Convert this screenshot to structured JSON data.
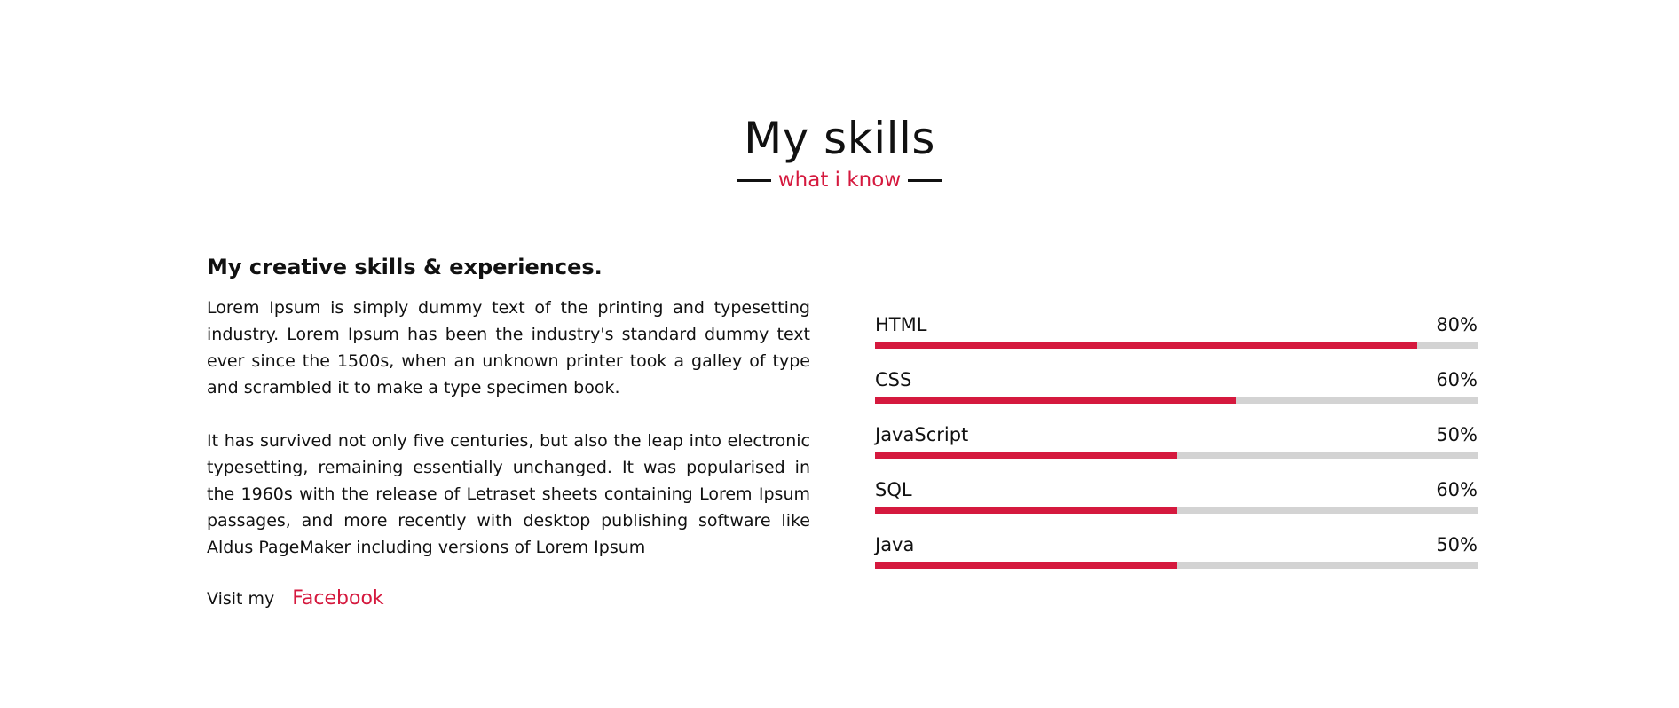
{
  "colors": {
    "accent": "#d5193e",
    "track": "#d3d3d3",
    "text": "#111111"
  },
  "header": {
    "title": "My skills",
    "subtitle": "what i know"
  },
  "about": {
    "heading": "My creative skills & experiences.",
    "paragraphs": [
      "Lorem Ipsum is simply dummy text of the printing and typesetting industry. Lorem Ipsum has been the industry's standard dummy text ever since the 1500s, when an unknown printer took a galley of type and scrambled it to make a type specimen book.",
      "It has survived not only five centuries, but also the leap into electronic typesetting, remaining essentially unchanged. It was popularised in the 1960s with the release of Letraset sheets containing Lorem Ipsum passages, and more recently with desktop publishing software like Aldus PageMaker including versions of Lorem Ipsum"
    ],
    "visit_prefix": "Visit my",
    "visit_link": "Facebook"
  },
  "skills": [
    {
      "name": "HTML",
      "percent_label": "80%",
      "fill": 0.9
    },
    {
      "name": "CSS",
      "percent_label": "60%",
      "fill": 0.6
    },
    {
      "name": "JavaScript",
      "percent_label": "50%",
      "fill": 0.5
    },
    {
      "name": "SQL",
      "percent_label": "60%",
      "fill": 0.5
    },
    {
      "name": "Java",
      "percent_label": "50%",
      "fill": 0.5
    }
  ]
}
